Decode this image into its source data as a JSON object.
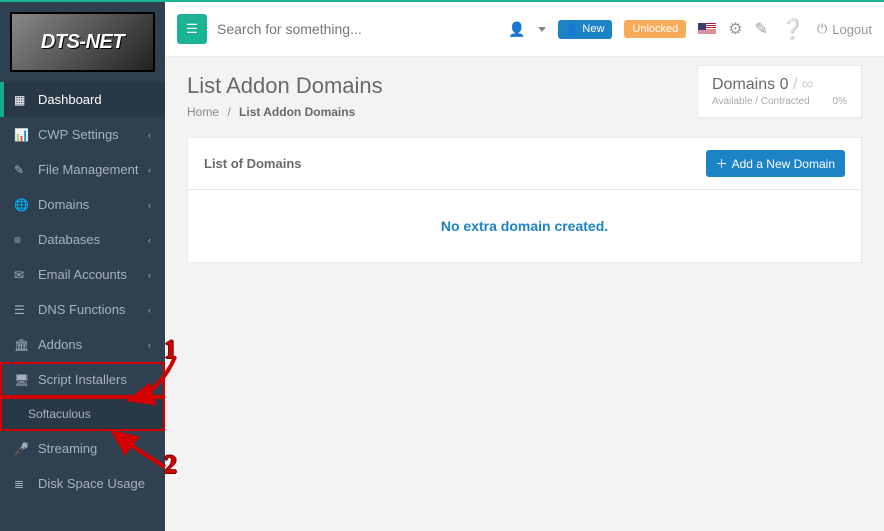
{
  "logo_text": "DTS-NET",
  "search": {
    "placeholder": "Search for something..."
  },
  "topbar": {
    "new_btn": "New",
    "unlocked_btn": "Unlocked",
    "logout": "Logout"
  },
  "page": {
    "title": "List Addon Domains",
    "breadcrumb_home": "Home",
    "breadcrumb_current": "List Addon Domains"
  },
  "domains_card": {
    "label": "Domains",
    "count": "0",
    "separator": "/",
    "infinity": "∞",
    "available_label": "Available / Contracted",
    "percent": "0%"
  },
  "panel": {
    "heading": "List of Domains",
    "add_button": "Add a New Domain",
    "empty_message": "No extra domain created."
  },
  "sidebar": {
    "items": [
      {
        "label": "Dashboard",
        "chev": false,
        "active": true
      },
      {
        "label": "CWP Settings",
        "chev": true
      },
      {
        "label": "File Management",
        "chev": true
      },
      {
        "label": "Domains",
        "chev": true
      },
      {
        "label": "Databases",
        "chev": true
      },
      {
        "label": "Email Accounts",
        "chev": true
      },
      {
        "label": "DNS Functions",
        "chev": true
      },
      {
        "label": "Addons",
        "chev": true
      },
      {
        "label": "Script Installers"
      },
      {
        "label": "Softaculous"
      },
      {
        "label": "Streaming"
      },
      {
        "label": "Disk Space Usage"
      }
    ]
  },
  "annotations": {
    "one": "1",
    "two": "2"
  }
}
